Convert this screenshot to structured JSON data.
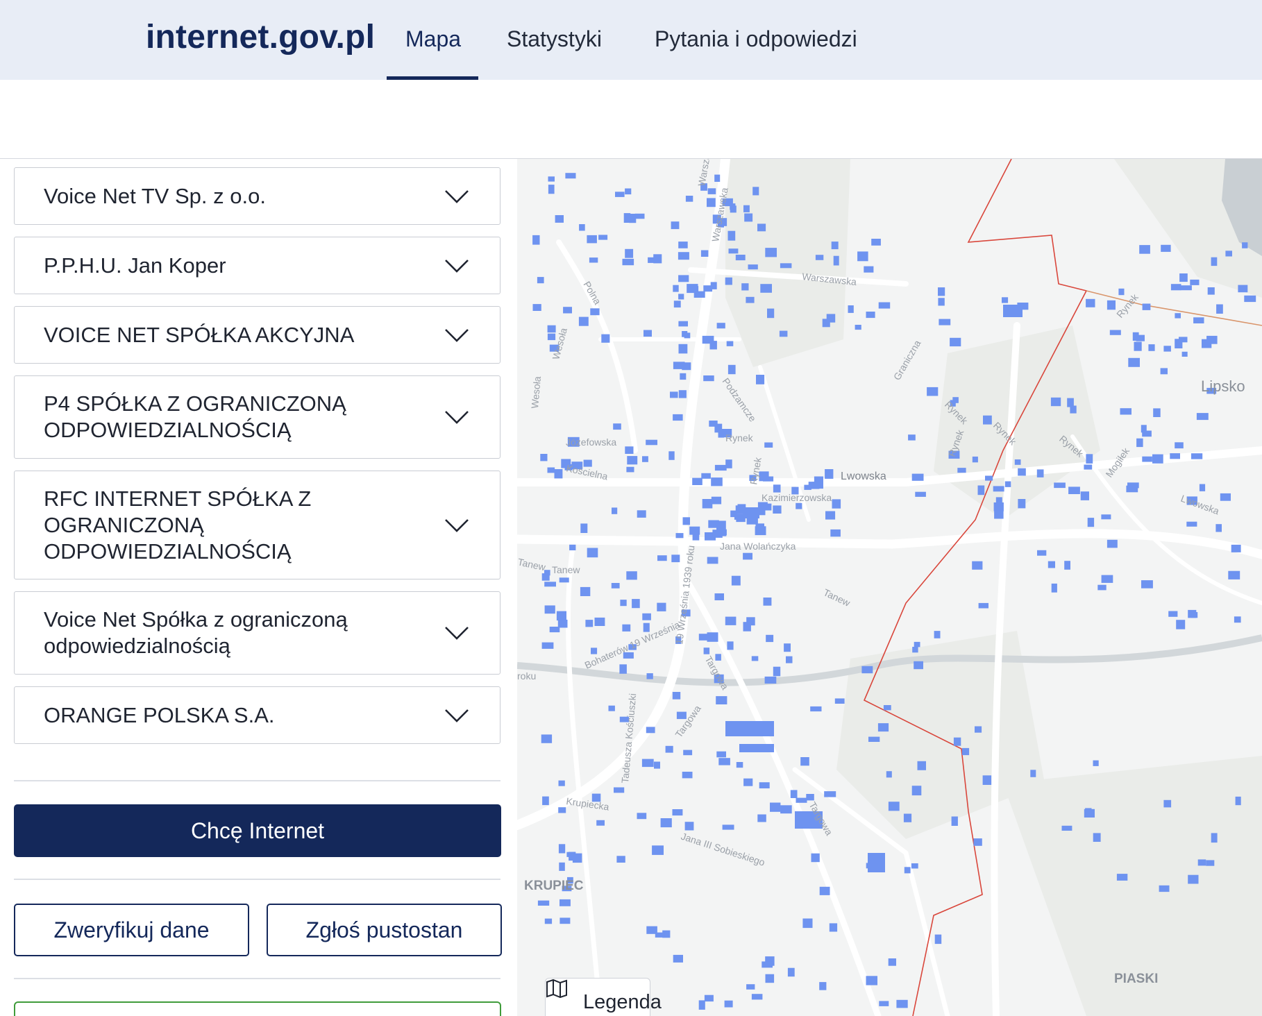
{
  "header": {
    "logo": "internet.gov.pl",
    "tabs": [
      {
        "label": "Mapa",
        "active": true
      },
      {
        "label": "Statystyki",
        "active": false
      },
      {
        "label": "Pytania i odpowiedzi",
        "active": false
      }
    ]
  },
  "providers": [
    "Voice Net TV Sp. z o.o.",
    "P.P.H.U. Jan Koper",
    "VOICE NET SPÓŁKA AKCYJNA",
    "P4 SPÓŁKA Z OGRANICZONĄ ODPOWIEDZIALNOŚCIĄ",
    "RFC INTERNET SPÓŁKA Z OGRANICZONĄ ODPOWIEDZIALNOŚCIĄ",
    "Voice Net Spółka z ograniczoną odpowiedzialnością",
    "ORANGE POLSKA S.A."
  ],
  "actions": {
    "primary": "Chcę Internet",
    "verify": "Zweryfikuj dane",
    "report_vacant": "Zgłoś pustostan"
  },
  "map": {
    "legend_label": "Legenda",
    "places": [
      {
        "label": "Lipsko",
        "kind": "town"
      },
      {
        "label": "KRUPIEC",
        "kind": "district"
      },
      {
        "label": "PIASKI",
        "kind": "district"
      }
    ],
    "streets": [
      "Warszawska",
      "Warszawska",
      "Warszawska",
      "Polna",
      "Wesoła",
      "Wesoła",
      "Józefowska",
      "Kościelna",
      "Podzamcze",
      "Rynek",
      "Rynek",
      "Lwowska",
      "Kazimierzowska",
      "Jana Wolańczyka",
      "19 Września 1939 roku",
      "Bohaterów 19 Września",
      "roku",
      "Tanew",
      "Tanew",
      "Tanew",
      "Targowa",
      "Targowa",
      "Targowa",
      "Tadeusza Kościuszki",
      "Krupiecka",
      "Jana III Sobieskiego",
      "Graniczna",
      "Rynek",
      "Rynek",
      "Rynek",
      "Rynek",
      "Rynek",
      "Mogiłek",
      "Lwowska"
    ],
    "colors": {
      "building": "#6e93f0",
      "road": "#ffffff",
      "boundary": "#d9463b",
      "background": "#f3f4f4",
      "water": "#c9cfd3"
    }
  }
}
